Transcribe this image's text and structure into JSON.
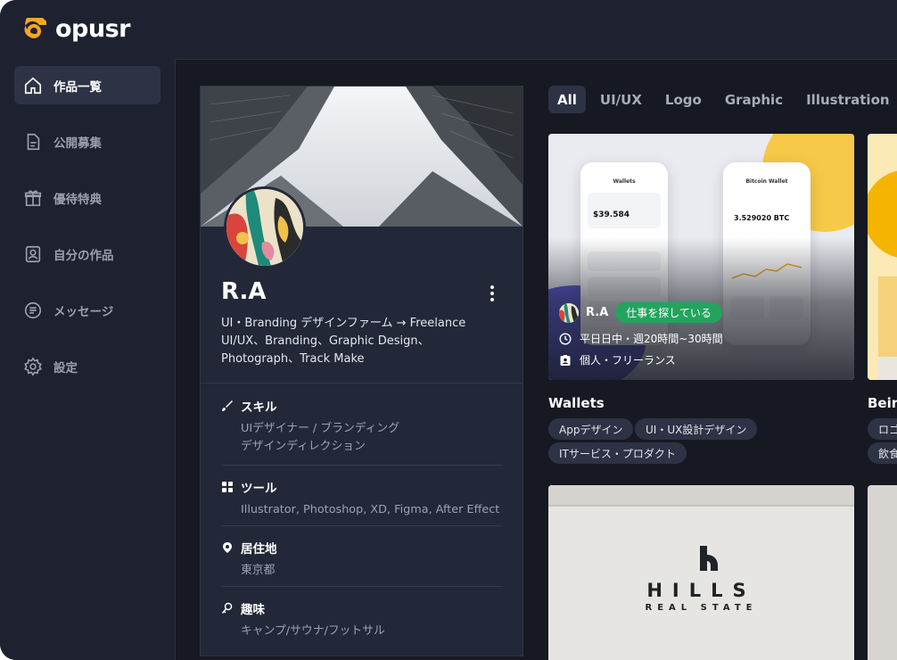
{
  "brand": {
    "name": "opusr",
    "accent": "#f5a623"
  },
  "nav": [
    {
      "label": "作品一覧",
      "icon": "home-icon",
      "active": true
    },
    {
      "label": "公開募集",
      "icon": "document-icon"
    },
    {
      "label": "優待特典",
      "icon": "gift-icon"
    },
    {
      "label": "自分の作品",
      "icon": "portrait-icon"
    },
    {
      "label": "メッセージ",
      "icon": "message-icon"
    },
    {
      "label": "設定",
      "icon": "gear-icon"
    }
  ],
  "profile": {
    "name": "R.A",
    "bio": [
      "UI・Branding デザインファーム → Freelance",
      "UI/UX、Branding、Graphic Design、",
      "Photograph、Track Make"
    ],
    "sections": [
      {
        "title": "スキル",
        "icon": "brush-icon",
        "lines": [
          "UIデザイナー / ブランディング",
          "デザインディレクション"
        ]
      },
      {
        "title": "ツール",
        "icon": "grid-icon",
        "lines": [
          "Illustrator, Photoshop, XD, Figma, After Effect"
        ]
      },
      {
        "title": "居住地",
        "icon": "location-pin-icon",
        "lines": [
          "東京都"
        ]
      },
      {
        "title": "趣味",
        "icon": "hobby-icon",
        "lines": [
          "キャンプ/サウナ/フットサル"
        ]
      }
    ]
  },
  "filters": [
    "All",
    "UI/UX",
    "Logo",
    "Graphic",
    "Illustration"
  ],
  "works": [
    {
      "title": "Wallets",
      "owner": "R.A",
      "status": "仕事を探している",
      "schedule": "平日日中・週20時間~30時間",
      "employment": "個人・フリーランス",
      "tags": [
        "Appデザイン",
        "UI・UX設計デザイン",
        "ITサービス・プロダクト"
      ],
      "screens": {
        "left": {
          "title": "Wallets",
          "balance": "$39.584"
        },
        "right": {
          "title": "Bitcoin Wallet",
          "balance": "3.529020 BTC"
        }
      }
    },
    {
      "title": "Beint",
      "tags": [
        "ロゴ",
        "飲食"
      ]
    }
  ],
  "work3": {
    "brand_line1": "HILLS",
    "brand_line2": "REAL STATE"
  },
  "colors": {
    "status_green": "#22a45d",
    "panel": "#232838",
    "background": "#161922"
  }
}
